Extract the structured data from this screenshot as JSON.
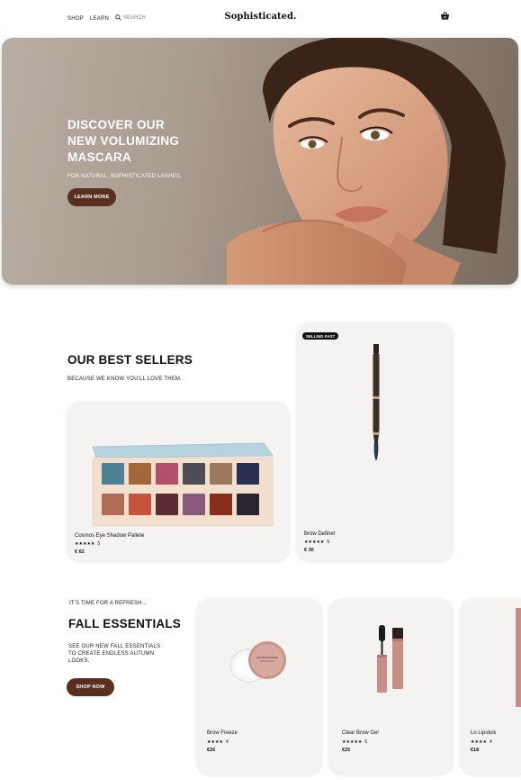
{
  "nav": {
    "shop": "SHOP",
    "learn": "LEARN",
    "search": "SEARCH",
    "brand": "Sophisticated.",
    "cart_icon": "basket-icon"
  },
  "hero": {
    "title_line1": "DISCOVER OUR",
    "title_line2": "NEW VOLUMIZING",
    "title_line3": "MASCARA",
    "subtitle": "FOR NATURAL, SOPHISTICATED LASHES.",
    "cta": "LEARN MORE"
  },
  "best_sellers": {
    "title": "OUR BEST SELLERS",
    "subtitle": "BECAUSE WE KNOW YOU'LL LOVE THEM.",
    "products": [
      {
        "name": "Cosmos Eye Shadow Pallete",
        "stars": "★★★★★",
        "rating": "5",
        "price": "€ 62"
      },
      {
        "name": "Brow Definer",
        "stars": "★★★★★",
        "rating": "5",
        "price": "€ 30",
        "badge": "SELLING FAST"
      }
    ]
  },
  "fall": {
    "eyebrow": "IT'S TIME FOR A REFRESH...",
    "title": "FALL ESSENTIALS",
    "desc_line1": "SEE OUR NEW FALL ESSENTIALS",
    "desc_line2": "TO CREATE ENDLESS AUTUMN",
    "desc_line3": "LOOKS.",
    "cta": "SHOP NOW",
    "products": [
      {
        "name": "Brow Freeze",
        "stars": "★★★★",
        "rating": "4",
        "price": "€26"
      },
      {
        "name": "Clear Brow Gel",
        "stars": "★★★★★",
        "rating": "5",
        "price": "€25"
      },
      {
        "name": "Lo Lipstick",
        "stars": "★★★★",
        "rating": "4",
        "price": "€18"
      }
    ]
  },
  "colors": {
    "accent": "#5a2f20",
    "card_bg": "#f4f3f1"
  },
  "palette_swatches": {
    "top_row": [
      "#4d8294",
      "#a2683b",
      "#b2506b",
      "#4e4c55",
      "#9a7a5f",
      "#2a3050"
    ],
    "bottom_row": [
      "#b06d55",
      "#c6543c",
      "#5d2c33",
      "#8a5a7a",
      "#8a2c1a",
      "#2a2530"
    ]
  }
}
